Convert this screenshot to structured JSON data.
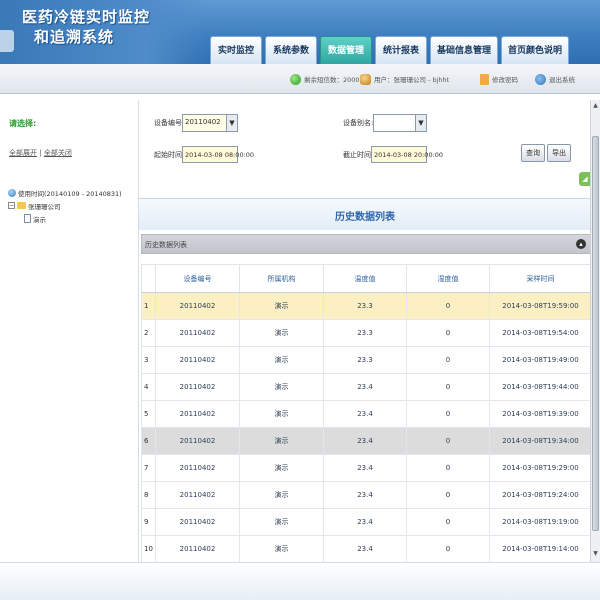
{
  "header": {
    "title_line1": "医药冷链实时监控",
    "title_line2": "和追溯系统",
    "tabs": [
      {
        "label": "实时监控",
        "active": false
      },
      {
        "label": "系统参数",
        "active": false
      },
      {
        "label": "数据管理",
        "active": true
      },
      {
        "label": "统计报表",
        "active": false
      },
      {
        "label": "基础信息管理",
        "active": false
      },
      {
        "label": "首页颜色说明",
        "active": false
      }
    ]
  },
  "statusbar": {
    "balance": "剩余短信数：2000",
    "user": "用户：张珊珊公司 - bjhht",
    "password": "修改密码",
    "logout": "退出系统"
  },
  "sidebar": {
    "title": "请选择:",
    "select_all": "全部展开",
    "separator": "|",
    "collapse_all": "全部关闭",
    "tree": {
      "root": "使用时间(20140109 - 20140831)",
      "company": "张珊珊公司",
      "node": "演示"
    }
  },
  "form": {
    "device_no_label": "设备编号:",
    "device_no_value": "20110402",
    "device_alias_label": "设备别名:",
    "device_alias_value": "",
    "start_label": "起始时间:",
    "start_value": "2014-03-08 08:00:00",
    "end_label": "截止时间:",
    "end_value": "2014-03-08 20:00:00",
    "query_button": "查询",
    "export_button": "导出"
  },
  "list": {
    "title": "历史数据列表",
    "caption": "历史数据列表",
    "columns": [
      "设备编号",
      "所属机构",
      "温度值",
      "湿度值",
      "采样时间"
    ],
    "rows": [
      {
        "n": "1",
        "device": "20110402",
        "org": "演示",
        "temp": "23.3",
        "hum": "0",
        "time": "2014-03-08T19:59:00"
      },
      {
        "n": "2",
        "device": "20110402",
        "org": "演示",
        "temp": "23.3",
        "hum": "0",
        "time": "2014-03-08T19:54:00"
      },
      {
        "n": "3",
        "device": "20110402",
        "org": "演示",
        "temp": "23.3",
        "hum": "0",
        "time": "2014-03-08T19:49:00"
      },
      {
        "n": "4",
        "device": "20110402",
        "org": "演示",
        "temp": "23.4",
        "hum": "0",
        "time": "2014-03-08T19:44:00"
      },
      {
        "n": "5",
        "device": "20110402",
        "org": "演示",
        "temp": "23.4",
        "hum": "0",
        "time": "2014-03-08T19:39:00"
      },
      {
        "n": "6",
        "device": "20110402",
        "org": "演示",
        "temp": "23.4",
        "hum": "0",
        "time": "2014-03-08T19:34:00"
      },
      {
        "n": "7",
        "device": "20110402",
        "org": "演示",
        "temp": "23.4",
        "hum": "0",
        "time": "2014-03-08T19:29:00"
      },
      {
        "n": "8",
        "device": "20110402",
        "org": "演示",
        "temp": "23.4",
        "hum": "0",
        "time": "2014-03-08T19:24:00"
      },
      {
        "n": "9",
        "device": "20110402",
        "org": "演示",
        "temp": "23.4",
        "hum": "0",
        "time": "2014-03-08T19:19:00"
      },
      {
        "n": "10",
        "device": "20110402",
        "org": "演示",
        "temp": "23.4",
        "hum": "0",
        "time": "2014-03-08T19:14:00"
      }
    ]
  },
  "colors": {
    "header_blue": "#3f7fc0",
    "active_tab": "#2ea7a0",
    "selected_row": "#fcefc4",
    "highlight_row": "#dcdcdc",
    "title_blue": "#2e66b0"
  },
  "icons": {
    "balance": "green-circle-icon",
    "user": "user-icon",
    "password": "document-icon",
    "logout": "exit-arrow-icon"
  }
}
